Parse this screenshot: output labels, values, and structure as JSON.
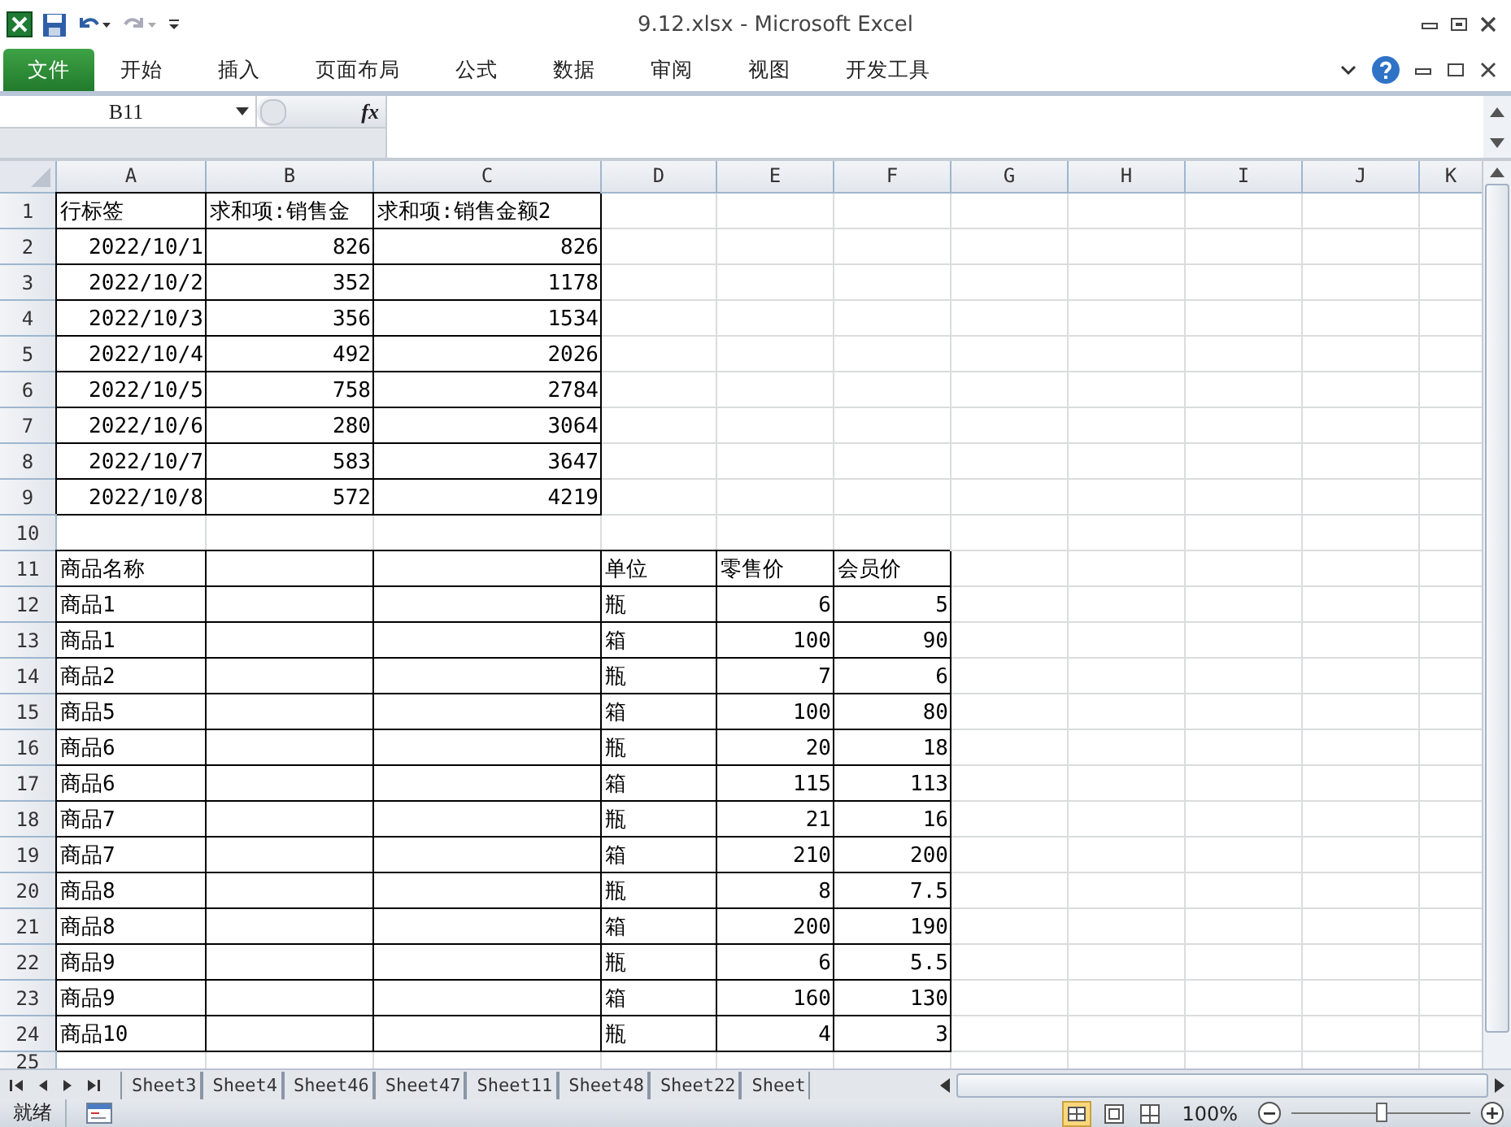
{
  "window": {
    "title": "9.12.xlsx  -  Microsoft Excel"
  },
  "ribbon_tabs": [
    {
      "label": "文件",
      "selected": true
    },
    {
      "label": "开始",
      "selected": false
    },
    {
      "label": "插入",
      "selected": false
    },
    {
      "label": "页面布局",
      "selected": false
    },
    {
      "label": "公式",
      "selected": false
    },
    {
      "label": "数据",
      "selected": false
    },
    {
      "label": "审阅",
      "selected": false
    },
    {
      "label": "视图",
      "selected": false
    },
    {
      "label": "开发工具",
      "selected": false
    }
  ],
  "formula_bar": {
    "name_box": "B11",
    "fx": "fx"
  },
  "columns": [
    "A",
    "B",
    "C",
    "D",
    "E",
    "F",
    "G",
    "H",
    "I",
    "J",
    "K"
  ],
  "rows": [
    {
      "number": "1",
      "cells": [
        {
          "kind": "text",
          "text": "行标签"
        },
        {
          "kind": "text",
          "text": "求和项:销售金"
        },
        {
          "kind": "text",
          "text": "求和项:销售金额2"
        }
      ]
    },
    {
      "number": "2",
      "cells": [
        {
          "kind": "number",
          "text": "2022/10/1"
        },
        {
          "kind": "number",
          "text": "826"
        },
        {
          "kind": "number",
          "text": "826"
        }
      ]
    },
    {
      "number": "3",
      "cells": [
        {
          "kind": "number",
          "text": "2022/10/2"
        },
        {
          "kind": "number",
          "text": "352"
        },
        {
          "kind": "number",
          "text": "1178"
        }
      ]
    },
    {
      "number": "4",
      "cells": [
        {
          "kind": "number",
          "text": "2022/10/3"
        },
        {
          "kind": "number",
          "text": "356"
        },
        {
          "kind": "number",
          "text": "1534"
        }
      ]
    },
    {
      "number": "5",
      "cells": [
        {
          "kind": "number",
          "text": "2022/10/4"
        },
        {
          "kind": "number",
          "text": "492"
        },
        {
          "kind": "number",
          "text": "2026"
        }
      ]
    },
    {
      "number": "6",
      "cells": [
        {
          "kind": "number",
          "text": "2022/10/5"
        },
        {
          "kind": "number",
          "text": "758"
        },
        {
          "kind": "number",
          "text": "2784"
        }
      ]
    },
    {
      "number": "7",
      "cells": [
        {
          "kind": "number",
          "text": "2022/10/6"
        },
        {
          "kind": "number",
          "text": "280"
        },
        {
          "kind": "number",
          "text": "3064"
        }
      ]
    },
    {
      "number": "8",
      "cells": [
        {
          "kind": "number",
          "text": "2022/10/7"
        },
        {
          "kind": "number",
          "text": "583"
        },
        {
          "kind": "number",
          "text": "3647"
        }
      ]
    },
    {
      "number": "9",
      "cells": [
        {
          "kind": "number",
          "text": "2022/10/8"
        },
        {
          "kind": "number",
          "text": "572"
        },
        {
          "kind": "number",
          "text": "4219"
        }
      ]
    },
    {
      "number": "10",
      "cells": []
    },
    {
      "number": "11",
      "cells": [
        {
          "kind": "text",
          "text": "商品名称"
        },
        {
          "kind": "blank"
        },
        {
          "kind": "blank"
        },
        {
          "kind": "text",
          "text": "单位"
        },
        {
          "kind": "text",
          "text": "零售价"
        },
        {
          "kind": "text",
          "text": "会员价"
        }
      ]
    },
    {
      "number": "12",
      "cells": [
        {
          "kind": "text",
          "text": "商品1"
        },
        {
          "kind": "blank"
        },
        {
          "kind": "blank"
        },
        {
          "kind": "text",
          "text": "瓶"
        },
        {
          "kind": "number",
          "text": "6"
        },
        {
          "kind": "number",
          "text": "5"
        }
      ]
    },
    {
      "number": "13",
      "cells": [
        {
          "kind": "text",
          "text": "商品1"
        },
        {
          "kind": "blank"
        },
        {
          "kind": "blank"
        },
        {
          "kind": "text",
          "text": "箱"
        },
        {
          "kind": "number",
          "text": "100"
        },
        {
          "kind": "number",
          "text": "90"
        }
      ]
    },
    {
      "number": "14",
      "cells": [
        {
          "kind": "text",
          "text": "商品2"
        },
        {
          "kind": "blank"
        },
        {
          "kind": "blank"
        },
        {
          "kind": "text",
          "text": "瓶"
        },
        {
          "kind": "number",
          "text": "7"
        },
        {
          "kind": "number",
          "text": "6"
        }
      ]
    },
    {
      "number": "15",
      "cells": [
        {
          "kind": "text",
          "text": "商品5"
        },
        {
          "kind": "blank"
        },
        {
          "kind": "blank"
        },
        {
          "kind": "text",
          "text": "箱"
        },
        {
          "kind": "number",
          "text": "100"
        },
        {
          "kind": "number",
          "text": "80"
        }
      ]
    },
    {
      "number": "16",
      "cells": [
        {
          "kind": "text",
          "text": "商品6"
        },
        {
          "kind": "blank"
        },
        {
          "kind": "blank"
        },
        {
          "kind": "text",
          "text": "瓶"
        },
        {
          "kind": "number",
          "text": "20"
        },
        {
          "kind": "number",
          "text": "18"
        }
      ]
    },
    {
      "number": "17",
      "cells": [
        {
          "kind": "text",
          "text": "商品6"
        },
        {
          "kind": "blank"
        },
        {
          "kind": "blank"
        },
        {
          "kind": "text",
          "text": "箱"
        },
        {
          "kind": "number",
          "text": "115"
        },
        {
          "kind": "number",
          "text": "113"
        }
      ]
    },
    {
      "number": "18",
      "cells": [
        {
          "kind": "text",
          "text": "商品7"
        },
        {
          "kind": "blank"
        },
        {
          "kind": "blank"
        },
        {
          "kind": "text",
          "text": "瓶"
        },
        {
          "kind": "number",
          "text": "21"
        },
        {
          "kind": "number",
          "text": "16"
        }
      ]
    },
    {
      "number": "19",
      "cells": [
        {
          "kind": "text",
          "text": "商品7"
        },
        {
          "kind": "blank"
        },
        {
          "kind": "blank"
        },
        {
          "kind": "text",
          "text": "箱"
        },
        {
          "kind": "number",
          "text": "210"
        },
        {
          "kind": "number",
          "text": "200"
        }
      ]
    },
    {
      "number": "20",
      "cells": [
        {
          "kind": "text",
          "text": "商品8"
        },
        {
          "kind": "blank"
        },
        {
          "kind": "blank"
        },
        {
          "kind": "text",
          "text": "瓶"
        },
        {
          "kind": "number",
          "text": "8"
        },
        {
          "kind": "number",
          "text": "7.5"
        }
      ]
    },
    {
      "number": "21",
      "cells": [
        {
          "kind": "text",
          "text": "商品8"
        },
        {
          "kind": "blank"
        },
        {
          "kind": "blank"
        },
        {
          "kind": "text",
          "text": "箱"
        },
        {
          "kind": "number",
          "text": "200"
        },
        {
          "kind": "number",
          "text": "190"
        }
      ]
    },
    {
      "number": "22",
      "cells": [
        {
          "kind": "text",
          "text": "商品9"
        },
        {
          "kind": "blank"
        },
        {
          "kind": "blank"
        },
        {
          "kind": "text",
          "text": "瓶"
        },
        {
          "kind": "number",
          "text": "6"
        },
        {
          "kind": "number",
          "text": "5.5"
        }
      ]
    },
    {
      "number": "23",
      "cells": [
        {
          "kind": "text",
          "text": "商品9"
        },
        {
          "kind": "blank"
        },
        {
          "kind": "blank"
        },
        {
          "kind": "text",
          "text": "箱"
        },
        {
          "kind": "number",
          "text": "160"
        },
        {
          "kind": "number",
          "text": "130"
        }
      ]
    },
    {
      "number": "24",
      "cells": [
        {
          "kind": "text",
          "text": "商品10"
        },
        {
          "kind": "blank"
        },
        {
          "kind": "blank"
        },
        {
          "kind": "text",
          "text": "瓶"
        },
        {
          "kind": "number",
          "text": "4"
        },
        {
          "kind": "number",
          "text": "3"
        }
      ]
    },
    {
      "number": "25",
      "cells": []
    }
  ],
  "sheet_tabs": [
    {
      "label": "Sheet3",
      "selected": false
    },
    {
      "label": "Sheet4",
      "selected": false
    },
    {
      "label": "Sheet46",
      "selected": false
    },
    {
      "label": "Sheet47",
      "selected": false
    },
    {
      "label": "Sheet11",
      "selected": false
    },
    {
      "label": "Sheet48",
      "selected": false
    },
    {
      "label": "Sheet22",
      "selected": false
    },
    {
      "label": "Sheet",
      "selected": false
    }
  ],
  "status_bar": {
    "status": "就绪",
    "zoom": "100%",
    "zoom_slider": {
      "level": 0.5
    }
  }
}
